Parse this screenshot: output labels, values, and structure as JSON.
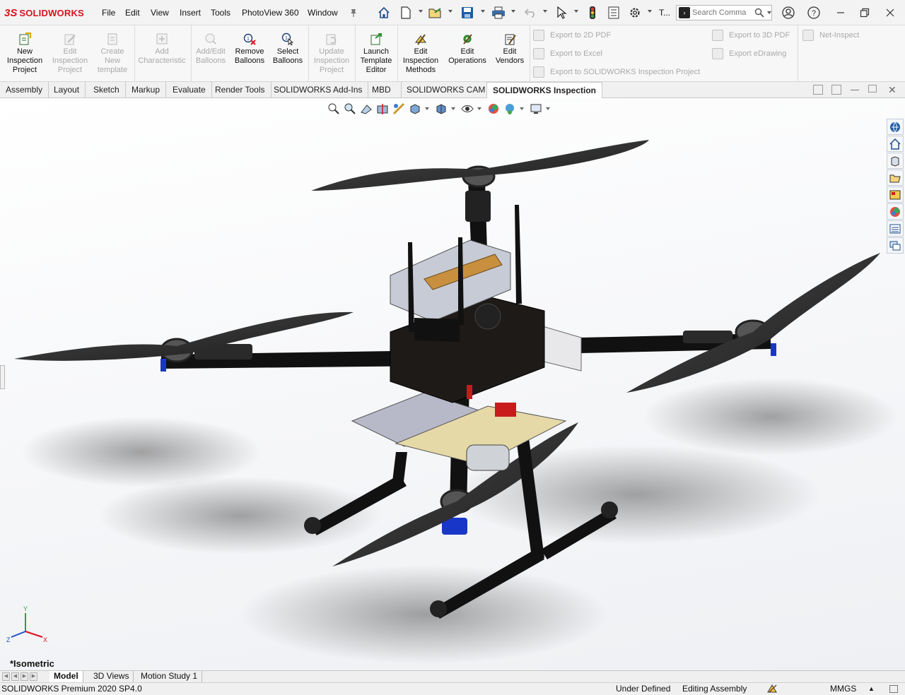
{
  "app": {
    "logo_text": "SOLIDWORKS",
    "logo_mark": "3S"
  },
  "menu": {
    "items": [
      "File",
      "Edit",
      "View",
      "Insert",
      "Tools",
      "PhotoView 360",
      "Window"
    ],
    "extra_truncated": "T...",
    "search_placeholder": "Search Comma"
  },
  "quick_access_icons": [
    "pin-icon",
    "home-icon",
    "new-document-icon",
    "open-icon",
    "save-icon",
    "print-icon",
    "undo-icon",
    "select-icon",
    "rebuild-icon",
    "file-properties-icon",
    "options-icon"
  ],
  "ribbon": {
    "buttons": [
      {
        "label1": "New",
        "label2": "Inspection",
        "label3": "Project",
        "enabled": true,
        "icon": "new-inspection-project-icon"
      },
      {
        "label1": "Edit",
        "label2": "Inspection",
        "label3": "Project",
        "enabled": false,
        "icon": "edit-inspection-project-icon"
      },
      {
        "label1": "Create",
        "label2": "New",
        "label3": "template",
        "enabled": false,
        "icon": "create-template-icon"
      },
      {
        "label1": "Add",
        "label2": "Characteristic",
        "label3": "",
        "enabled": false,
        "icon": "add-characteristic-icon"
      },
      {
        "label1": "Add/Edit",
        "label2": "Balloons",
        "label3": "",
        "enabled": false,
        "icon": "add-edit-balloons-icon"
      },
      {
        "label1": "Remove",
        "label2": "Balloons",
        "label3": "",
        "enabled": true,
        "icon": "remove-balloons-icon"
      },
      {
        "label1": "Select",
        "label2": "Balloons",
        "label3": "",
        "enabled": true,
        "icon": "select-balloons-icon"
      },
      {
        "label1": "Update",
        "label2": "Inspection",
        "label3": "Project",
        "enabled": false,
        "icon": "update-inspection-project-icon"
      },
      {
        "label1": "Launch",
        "label2": "Template",
        "label3": "Editor",
        "enabled": true,
        "icon": "launch-template-editor-icon"
      },
      {
        "label1": "Edit",
        "label2": "Inspection",
        "label3": "Methods",
        "enabled": true,
        "icon": "edit-inspection-methods-icon"
      },
      {
        "label1": "Edit",
        "label2": "Operations",
        "label3": "",
        "enabled": true,
        "icon": "edit-operations-icon"
      },
      {
        "label1": "Edit",
        "label2": "Vendors",
        "label3": "",
        "enabled": true,
        "icon": "edit-vendors-icon"
      }
    ],
    "exports": [
      {
        "label": "Export to 2D PDF"
      },
      {
        "label": "Export to Excel"
      },
      {
        "label": "Export to SOLIDWORKS Inspection Project"
      },
      {
        "label": "Export to 3D PDF"
      },
      {
        "label": "Export eDrawing"
      },
      {
        "label": "Net-Inspect"
      }
    ]
  },
  "command_tabs": [
    "Assembly",
    "Layout",
    "Sketch",
    "Markup",
    "Evaluate",
    "Render Tools",
    "SOLIDWORKS Add-Ins",
    "MBD",
    "SOLIDWORKS CAM",
    "SOLIDWORKS Inspection"
  ],
  "active_command_tab": "SOLIDWORKS Inspection",
  "headsup_icons": [
    "zoom-to-fit-icon",
    "zoom-to-area-icon",
    "previous-view-icon",
    "section-view-icon",
    "dynamic-annotation-icon",
    "view-orientation-icon",
    "display-style-icon",
    "hide-show-items-icon",
    "edit-appearance-icon",
    "apply-scene-icon",
    "view-settings-icon"
  ],
  "task_pane_icons": [
    "solidworks-resources-icon",
    "design-library-icon",
    "file-explorer-icon",
    "view-palette-icon",
    "appearances-icon",
    "custom-properties-icon",
    "forum-icon"
  ],
  "viewport": {
    "view_label": "*Isometric",
    "triad": {
      "x": "X",
      "y": "Y",
      "z": "Z"
    }
  },
  "bottom_tabs": [
    "Model",
    "3D Views",
    "Motion Study 1"
  ],
  "active_bottom_tab": "Model",
  "status": {
    "product": "SOLIDWORKS Premium 2020 SP4.0",
    "definition": "Under Defined",
    "mode": "Editing Assembly",
    "units": "MMGS"
  }
}
